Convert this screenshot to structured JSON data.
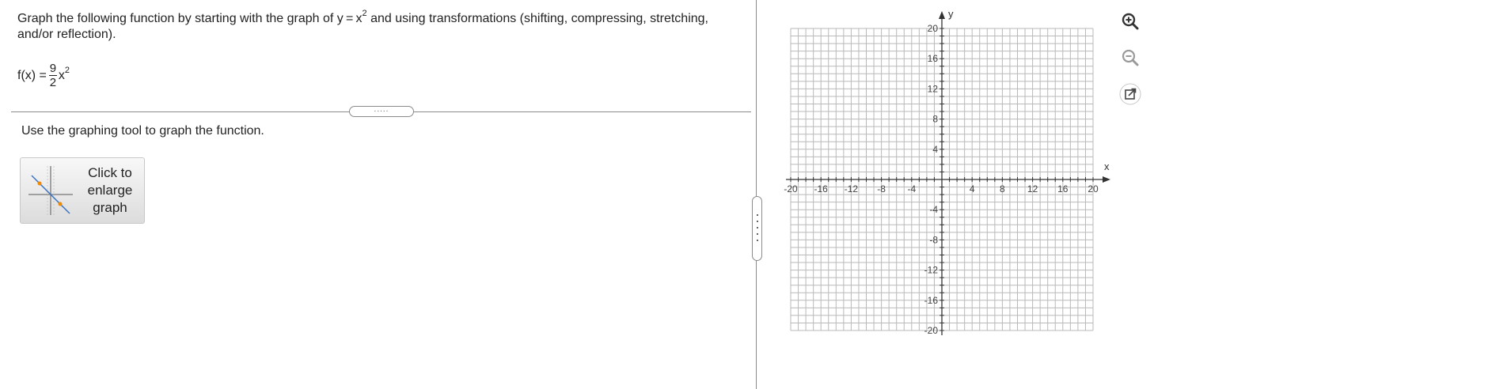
{
  "question": {
    "prompt_part1": "Graph the following function by starting with the graph of y = x",
    "prompt_exp": "2",
    "prompt_part2": " and using transformations (shifting, compressing, stretching, and/or reflection).",
    "function_lhs": "f(x) = ",
    "coef_numerator": "9",
    "coef_denominator": "2",
    "function_var": "x",
    "function_exp": "2",
    "divider_handle": "....."
  },
  "instructions": "Use the graphing tool to graph the function.",
  "enlarge_button": {
    "label": "Click to\nenlarge\ngraph"
  },
  "graph": {
    "x_axis_label": "x",
    "y_axis_label": "y",
    "x_range": [
      -20,
      20
    ],
    "y_range": [
      -20,
      20
    ],
    "grid_step": 1,
    "tick_step": 4,
    "x_tick_labels": [
      "-20",
      "-16",
      "-12",
      "-8",
      "-4",
      "4",
      "8",
      "12",
      "16",
      "20"
    ],
    "y_tick_labels": [
      "20",
      "16",
      "12",
      "8",
      "4",
      "-4",
      "-8",
      "-12",
      "-16",
      "-20"
    ],
    "grid_color": "#b9b9b9",
    "axis_color": "#333333"
  },
  "tools": [
    {
      "name": "zoom-in-icon"
    },
    {
      "name": "zoom-out-icon"
    },
    {
      "name": "popout-icon"
    }
  ]
}
